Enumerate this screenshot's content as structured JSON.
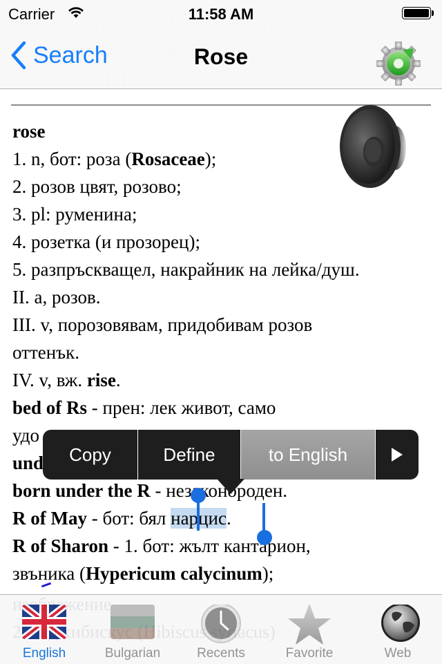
{
  "status_bar": {
    "carrier": "Carrier",
    "time": "11:58 AM",
    "wifi_icon": "wifi-icon",
    "battery_icon": "battery-full-icon",
    "battery_level": 1.0
  },
  "nav": {
    "back_label": "Search",
    "title": "Rose",
    "back_icon": "chevron-left-icon",
    "refresh_icon": "gear-refresh-icon",
    "scrolled_text_under_nav": [
      "роза[s]roza[/][p]noun[/]роза, розетка, розов",
      "шарка, диамантена рязка",
      "разпръсквач[p]adjective[/]розов"
    ]
  },
  "entry": {
    "headword": "rose",
    "speaker_icon": "speaker-icon",
    "lines": [
      {
        "parts": [
          {
            "t": "1. n, бот: роза (",
            "b": false
          },
          {
            "t": "Rosaceae",
            "b": true
          },
          {
            "t": ");",
            "b": false
          }
        ]
      },
      {
        "parts": [
          {
            "t": "2. розов цвят, розово;",
            "b": false
          }
        ]
      },
      {
        "parts": [
          {
            "t": "3. pl: руменина;",
            "b": false
          }
        ]
      },
      {
        "parts": [
          {
            "t": "4. розетка (и прозорец);",
            "b": false
          }
        ]
      },
      {
        "parts": [
          {
            "t": "5. разпръскващел, накрайник на лейка/душ.",
            "b": false
          }
        ]
      },
      {
        "parts": [
          {
            "t": "II. a, розов.",
            "b": false
          }
        ]
      },
      {
        "parts": [
          {
            "t": "III. v, порозовявам, придобивам розов",
            "b": false
          }
        ]
      },
      {
        "parts": [
          {
            "t": "оттенък.",
            "b": false
          }
        ]
      },
      {
        "parts": [
          {
            "t": "IV. v, вж. ",
            "b": false
          },
          {
            "t": "rise",
            "b": true
          },
          {
            "t": ".",
            "b": false
          }
        ]
      },
      {
        "parts": [
          {
            "t": "bed of Rs",
            "b": true
          },
          {
            "t": " - прен: лек живот, само",
            "b": false
          }
        ]
      },
      {
        "parts": [
          {
            "t": "удо",
            "b": false
          }
        ]
      },
      {
        "parts": [
          {
            "t": "und",
            "b": true
          }
        ]
      },
      {
        "parts": [
          {
            "t": "born under the R",
            "b": true
          },
          {
            "t": " - незаконороден.",
            "b": false
          }
        ]
      }
    ],
    "may_line": {
      "bold": "R of May",
      "before_sel": " - бот: бял ",
      "selected": "нарцис",
      "after_sel": "."
    },
    "sharon_line_1": {
      "bold": "R of Sharon",
      "rest": " - 1. бот: жълт кантарион,"
    },
    "sharon_line_2": {
      "before": "звъника (",
      "bold": "Hypericum calycinum",
      "after": ");"
    },
    "scrolled_text_under_tabbar": [
      "изображение",
      "2. вид хибискус (Hibiscus syriacus)"
    ]
  },
  "edit_menu": {
    "items": [
      "Copy",
      "Define",
      "to English"
    ],
    "more_icon": "triangle-right-icon",
    "highlighted_item": "to English"
  },
  "colors": {
    "accent": "#157efb",
    "selection": "#c5dbf1",
    "handle": "#1a6fe0",
    "tab_active": "#1a77d8",
    "tab_inactive": "#929292"
  },
  "tabs": [
    {
      "label": "English",
      "icon": "uk-flag-icon",
      "active": true
    },
    {
      "label": "Bulgarian",
      "icon": "bulgaria-flag-icon",
      "active": false
    },
    {
      "label": "Recents",
      "icon": "clock-icon",
      "active": false
    },
    {
      "label": "Favorite",
      "icon": "star-icon",
      "active": false
    },
    {
      "label": "Web",
      "icon": "globe-icon",
      "active": false
    }
  ]
}
